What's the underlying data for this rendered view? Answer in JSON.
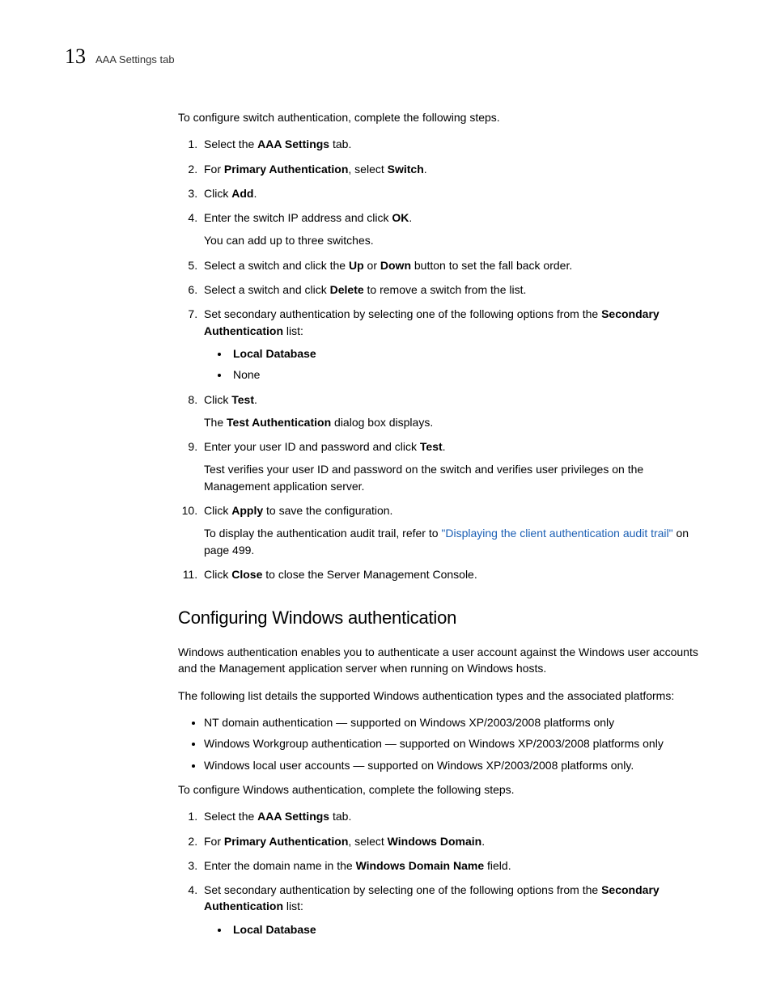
{
  "header": {
    "chapter_number": "13",
    "running_title": "AAA Settings tab"
  },
  "intro1": "To configure switch authentication, complete the following steps.",
  "steps1": {
    "s1": {
      "pre": "Select the ",
      "bold": "AAA Settings",
      "post": " tab."
    },
    "s2": {
      "pre": "For ",
      "bold1": "Primary Authentication",
      "mid": ", select ",
      "bold2": "Switch",
      "post": "."
    },
    "s3": {
      "pre": "Click ",
      "bold": "Add",
      "post": "."
    },
    "s4": {
      "pre": "Enter the switch IP address and click ",
      "bold": "OK",
      "post": ".",
      "sub": "You can add up to three switches."
    },
    "s5": {
      "pre": "Select a switch and click the ",
      "bold1": "Up",
      "mid": " or ",
      "bold2": "Down",
      "post": " button to set the fall back order."
    },
    "s6": {
      "pre": "Select a switch and click ",
      "bold": "Delete",
      "post": " to remove a switch from the list."
    },
    "s7": {
      "pre": "Set secondary authentication by selecting one of the following options from the ",
      "bold": "Secondary Authentication",
      "post": " list:",
      "bullet1": "Local Database",
      "bullet2": "None"
    },
    "s8": {
      "pre": "Click ",
      "bold": "Test",
      "post": ".",
      "sub_pre": "The ",
      "sub_bold": "Test Authentication",
      "sub_post": " dialog box displays."
    },
    "s9": {
      "pre": "Enter your user ID and password and click ",
      "bold": "Test",
      "post": ".",
      "sub": "Test verifies your user ID and password on the switch and verifies user privileges on the Management application server."
    },
    "s10": {
      "pre": "Click ",
      "bold": "Apply",
      "post": " to save the configuration.",
      "sub_pre": "To display the authentication audit trail, refer to ",
      "sub_link": "\"Displaying the client authentication audit trail\"",
      "sub_post": " on page 499."
    },
    "s11": {
      "pre": "Click ",
      "bold": "Close",
      "post": " to close the Server Management Console."
    }
  },
  "section2": {
    "heading": "Configuring Windows authentication",
    "p1": "Windows authentication enables you to authenticate a user account against the Windows user accounts and the Management application server when running on Windows hosts.",
    "p2": "The following list details the supported Windows authentication types and the associated platforms:",
    "bullets": {
      "b1": "NT domain authentication — supported on Windows XP/2003/2008 platforms only",
      "b2": "Windows Workgroup authentication — supported on Windows XP/2003/2008 platforms only",
      "b3": "Windows local user accounts — supported on Windows XP/2003/2008 platforms only."
    },
    "p3": "To configure Windows authentication, complete the following steps.",
    "steps": {
      "s1": {
        "pre": "Select the ",
        "bold": "AAA Settings",
        "post": " tab."
      },
      "s2": {
        "pre": "For ",
        "bold1": "Primary Authentication",
        "mid": ", select ",
        "bold2": "Windows Domain",
        "post": "."
      },
      "s3": {
        "pre": "Enter the domain name in the ",
        "bold": "Windows Domain Name",
        "post": " field."
      },
      "s4": {
        "pre": "Set secondary authentication by selecting one of the following options from the ",
        "bold": "Secondary Authentication",
        "post": " list:",
        "bullet1": "Local Database"
      }
    }
  }
}
